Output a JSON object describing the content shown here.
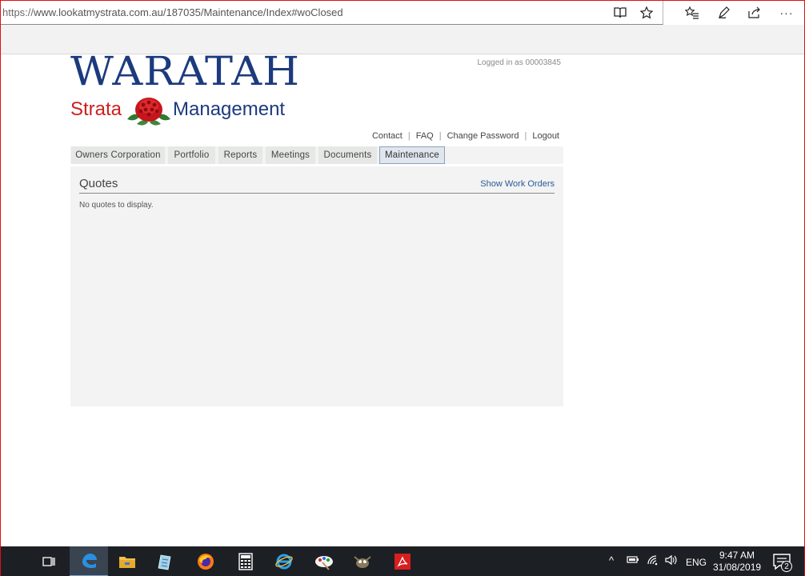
{
  "browser": {
    "url_scheme": "https://",
    "url_rest": "www.lookatmystrata.com.au/187035/Maintenance/Index#woClosed",
    "icons": [
      "reading-view-icon",
      "favorite-star-icon",
      "favorites-hub-icon",
      "pen-icon",
      "share-icon",
      "more-icon"
    ],
    "more_label": "···"
  },
  "header": {
    "logo_title": "WARATAH",
    "logo_strata": "Strata",
    "logo_management": "Management",
    "logged_in": "Logged in as 00003845",
    "links": [
      "Contact",
      "FAQ",
      "Change Password",
      "Logout"
    ],
    "separator": "|"
  },
  "nav": {
    "tabs": [
      "Owners Corporation",
      "Portfolio",
      "Reports",
      "Meetings",
      "Documents",
      "Maintenance"
    ],
    "active": "Maintenance"
  },
  "main": {
    "title": "Quotes",
    "show_work_orders": "Show Work Orders",
    "empty_message": "No quotes to display."
  },
  "taskbar": {
    "apps": [
      "task-view-icon",
      "edge-icon",
      "file-explorer-icon",
      "notepad-icon",
      "firefox-icon",
      "calculator-icon",
      "internet-explorer-icon",
      "paint-icon",
      "gimp-icon",
      "acrobat-icon"
    ],
    "active_app": "edge-icon",
    "tray_chevron": "^",
    "language": "ENG",
    "time": "9:47 AM",
    "date": "31/08/2019",
    "notification_count": "2"
  },
  "colors": {
    "brand_blue": "#1c3a7e",
    "brand_red": "#cc1f1f",
    "link_blue": "#2a5a9a",
    "panel_bg": "#f2f3f2",
    "taskbar_bg": "#1c1f24"
  }
}
